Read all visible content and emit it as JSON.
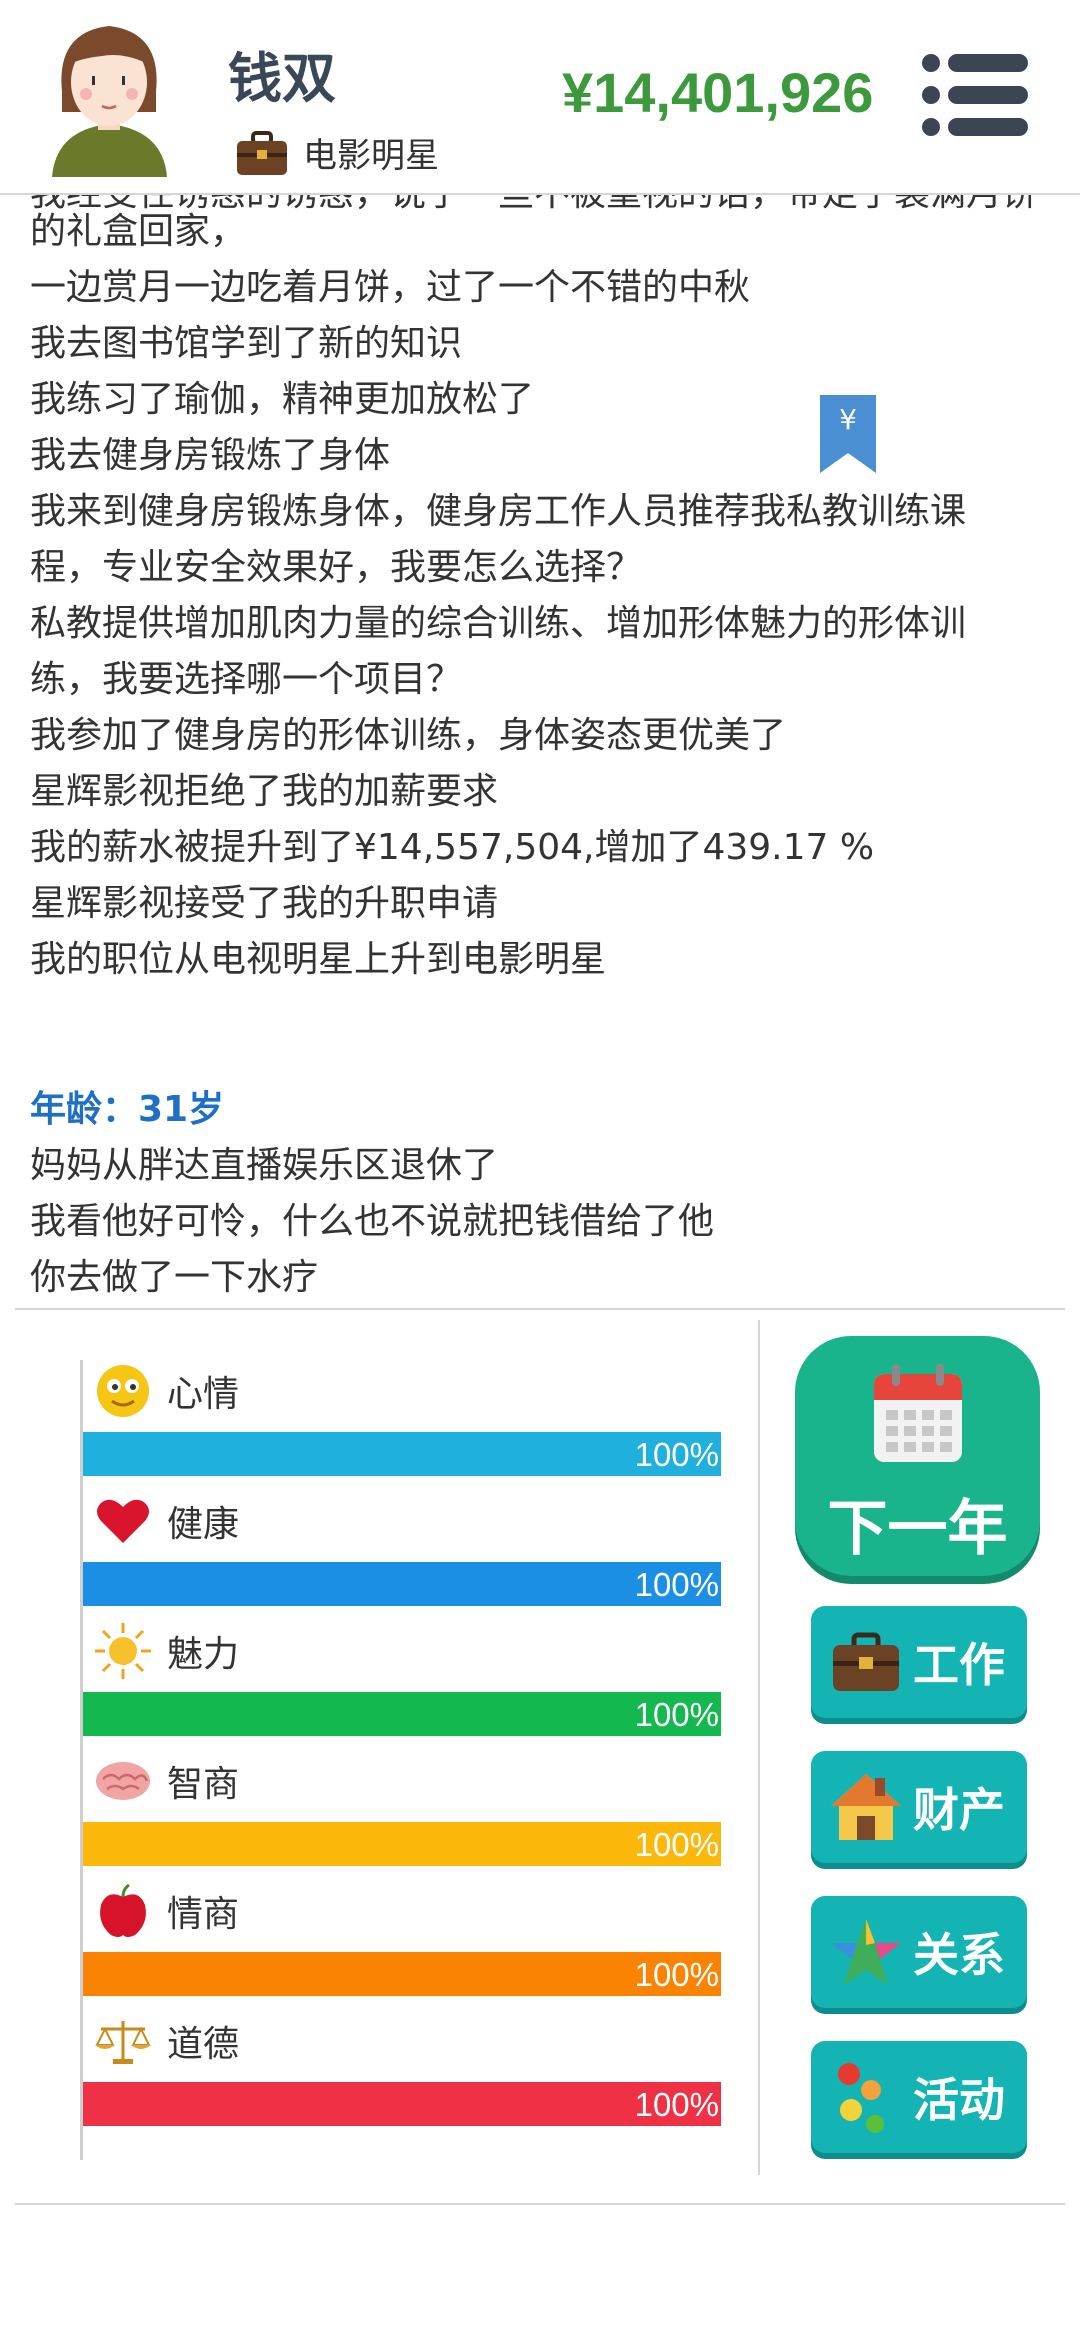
{
  "header": {
    "name": "钱双",
    "job": "电影明星",
    "money": "¥14,401,926"
  },
  "log": {
    "lines_before": [
      "我经受住诱惑的诱惑，说了一些不被重视的话，带走了装满月饼的礼盒回家，",
      "一边赏月一边吃着月饼，过了一个不错的中秋",
      "我去图书馆学到了新的知识",
      "我练习了瑜伽，精神更加放松了",
      "我去健身房锻炼了身体",
      "我来到健身房锻炼身体，健身房工作人员推荐我私教训练课",
      "程，专业安全效果好，我要怎么选择？",
      "私教提供增加肌肉力量的综合训练、增加形体魅力的形体训",
      "练，我要选择哪一个项目？",
      "我参加了健身房的形体训练，身体姿态更优美了",
      "星辉影视拒绝了我的加薪要求",
      "我的薪水被提升到了¥14,557,504,增加了439.17 %",
      "星辉影视接受了我的升职申请",
      "我的职位从电视明星上升到电影明星"
    ],
    "age": "年龄：31岁",
    "lines_after": [
      "妈妈从胖达直播娱乐区退休了",
      "我看他好可怜，什么也不说就把钱借给了他",
      "你去做了一下水疗"
    ]
  },
  "stats": [
    {
      "label": "心情",
      "value": "100%",
      "level": 1.0,
      "color": "#1fb0dd",
      "icon": "smiley-icon"
    },
    {
      "label": "健康",
      "value": "100%",
      "level": 1.0,
      "color": "#1a8fe3",
      "icon": "heart-icon"
    },
    {
      "label": "魅力",
      "value": "100%",
      "level": 1.0,
      "color": "#13b84e",
      "icon": "sun-icon"
    },
    {
      "label": "智商",
      "value": "100%",
      "level": 1.0,
      "color": "#fbb80b",
      "icon": "brain-icon"
    },
    {
      "label": "情商",
      "value": "100%",
      "level": 1.0,
      "color": "#fb8304",
      "icon": "apple-icon"
    },
    {
      "label": "道德",
      "value": "100%",
      "level": 1.0,
      "color": "#ee3145",
      "icon": "scales-icon"
    }
  ],
  "actions": {
    "next_year": "下一年",
    "work": "工作",
    "property": "财产",
    "relations": "关系",
    "activities": "活动"
  }
}
